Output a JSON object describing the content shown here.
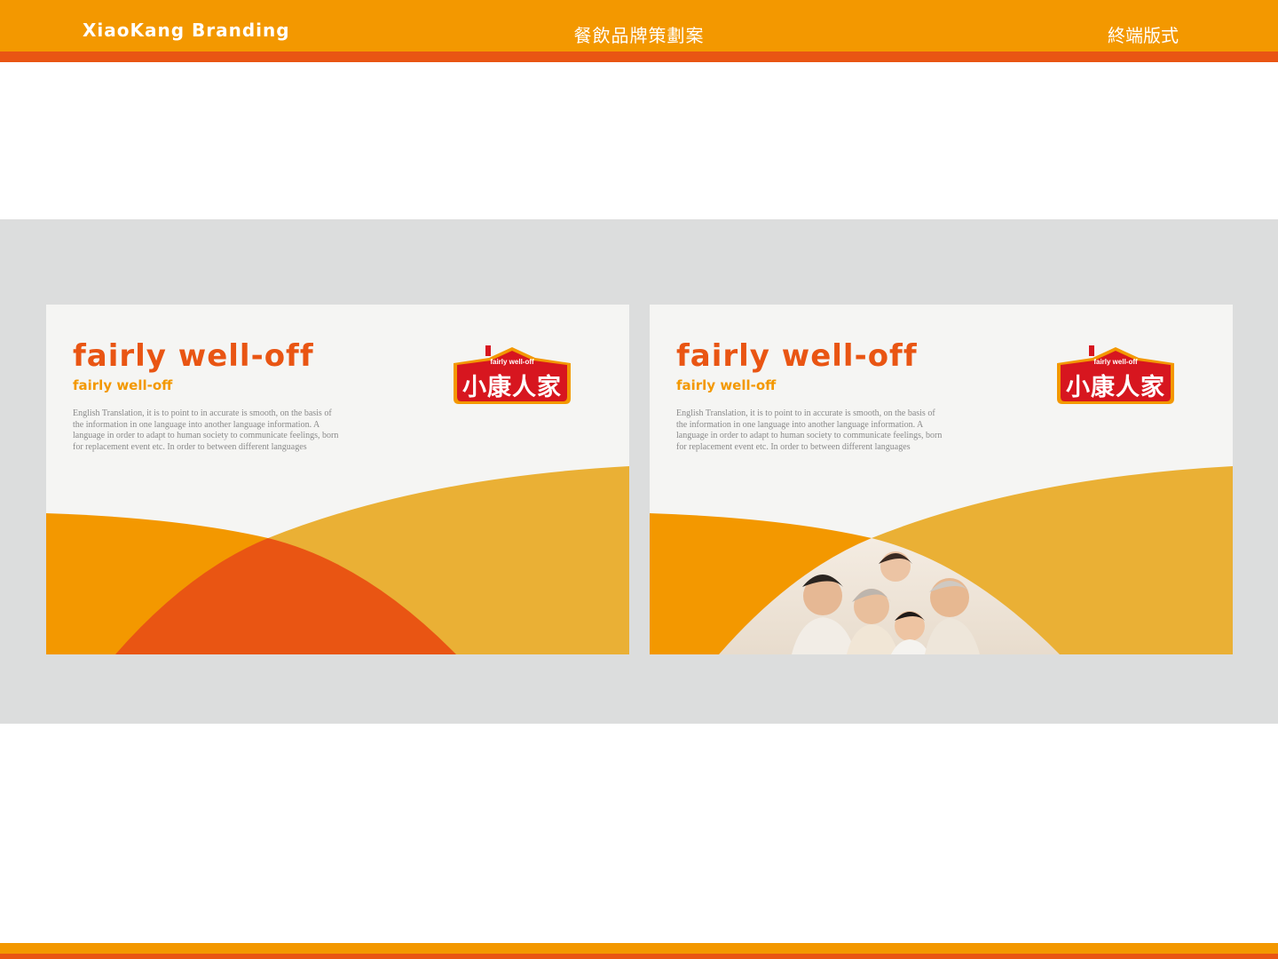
{
  "header": {
    "brand": "XiaoKang Branding",
    "title": "餐飲品牌策劃案",
    "section": "終端版式"
  },
  "colors": {
    "orange": "#f39800",
    "red_orange": "#e95513",
    "yellow": "#eab035",
    "logo_red": "#d7161f",
    "gray_band": "#dcdddd"
  },
  "cards": [
    {
      "heading": "fairly well-off",
      "subheading": "fairly well-off",
      "body": "English Translation, it is to point to in accurate is smooth, on the basis of the information in one language into another language information. A language in order to adapt to human society to communicate feelings, born for replacement event etc. In order to between different languages",
      "logo_en": "fairly well-off",
      "logo_cn": "小康人家"
    },
    {
      "heading": "fairly well-off",
      "subheading": "fairly well-off",
      "body": "English Translation, it is to point to in accurate is smooth, on the basis of the information in one language into another language information. A language in order to adapt to human society to communicate feelings, born for replacement event etc. In order to between different languages",
      "logo_en": "fairly well-off",
      "logo_cn": "小康人家"
    }
  ]
}
